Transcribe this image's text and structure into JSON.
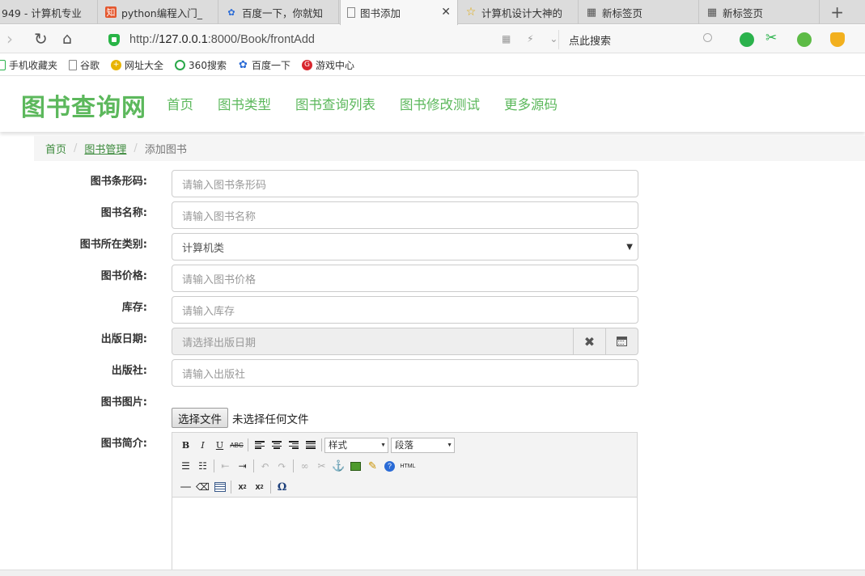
{
  "browser": {
    "tabs": [
      {
        "label": "949 - 计算机专业"
      },
      {
        "label": "python编程入门_"
      },
      {
        "label": "百度一下，你就知"
      },
      {
        "label": "图书添加"
      },
      {
        "label": "计算机设计大神的"
      },
      {
        "label": "新标签页"
      },
      {
        "label": "新标签页"
      }
    ],
    "new_tab": "+",
    "url_prefix": "http://",
    "url_host": "127.0.0.1",
    "url_rest": ":8000/Book/frontAdd",
    "search_placeholder": "点此搜索",
    "bookmarks": [
      {
        "label": "手机收藏夹"
      },
      {
        "label": "谷歌"
      },
      {
        "label": "网址大全"
      },
      {
        "label": "360搜索"
      },
      {
        "label": "百度一下"
      },
      {
        "label": "游戏中心"
      }
    ]
  },
  "site": {
    "brand": "图书查询网",
    "nav": [
      "首页",
      "图书类型",
      "图书查询列表",
      "图书修改测试",
      "更多源码"
    ],
    "accent_color": "#5cb85c"
  },
  "breadcrumb": {
    "home": "首页",
    "section": "图书管理",
    "current": "添加图书",
    "separator": "/"
  },
  "form": {
    "barcode": {
      "label": "图书条形码:",
      "placeholder": "请输入图书条形码"
    },
    "name": {
      "label": "图书名称:",
      "placeholder": "请输入图书名称"
    },
    "category": {
      "label": "图书所在类别:",
      "value": "计算机类"
    },
    "price": {
      "label": "图书价格:",
      "placeholder": "请输入图书价格"
    },
    "stock": {
      "label": "库存:",
      "placeholder": "请输入库存"
    },
    "publish_date": {
      "label": "出版日期:",
      "placeholder": "请选择出版日期"
    },
    "publisher": {
      "label": "出版社:",
      "placeholder": "请输入出版社"
    },
    "image": {
      "label": "图书图片:",
      "button": "选择文件",
      "status": "未选择任何文件"
    },
    "intro": {
      "label": "图书简介:"
    }
  },
  "editor": {
    "style_select": "样式",
    "paragraph_select": "段落",
    "html_button": "HTML"
  }
}
